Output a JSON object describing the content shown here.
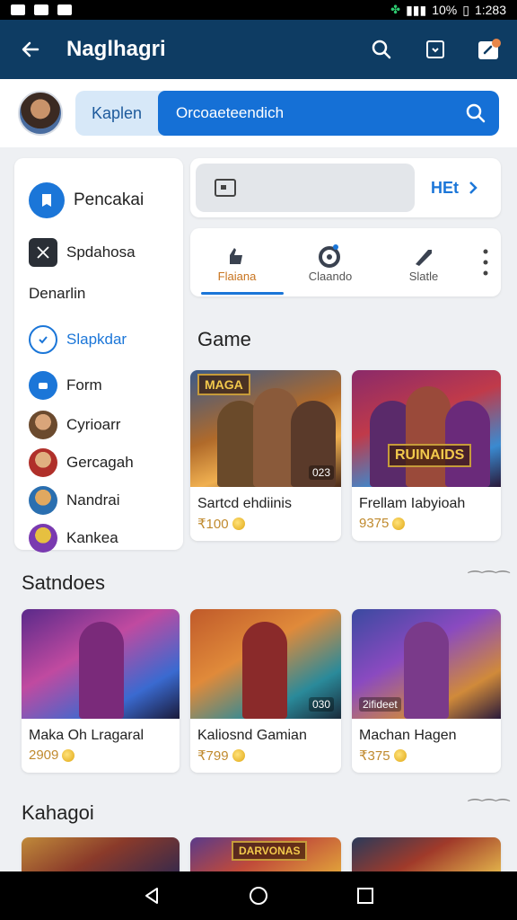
{
  "status": {
    "battery": "10%",
    "time": "1:283"
  },
  "appbar": {
    "title": "Naglhagri"
  },
  "search": {
    "tag": "Kaplen",
    "placeholder": "Orcoaeteendich"
  },
  "sidebar": {
    "items": [
      {
        "label": "Pencakai",
        "icon": "bookmark-icon"
      },
      {
        "label": "Spdahosa",
        "icon": "image-icon"
      },
      {
        "label": "Denarlin",
        "icon": ""
      },
      {
        "label": "Slapkdar",
        "icon": "badge-icon"
      },
      {
        "label": "Form",
        "icon": "user-icon"
      },
      {
        "label": "Cyrioarr",
        "icon": "avatar-icon"
      },
      {
        "label": "Gercagah",
        "icon": "avatar-icon"
      },
      {
        "label": "Nandrai",
        "icon": "avatar-icon"
      },
      {
        "label": "Kankea",
        "icon": "avatar-icon"
      }
    ]
  },
  "promo": {
    "more_label": "HEt"
  },
  "tabs": [
    {
      "label": "Flaiana",
      "icon": "hand-icon"
    },
    {
      "label": "Claando",
      "icon": "target-icon"
    },
    {
      "label": "Slatle",
      "icon": "sword-icon"
    }
  ],
  "sections": {
    "game": {
      "title": "Game",
      "cards": [
        {
          "name": "Sartcd ehdiinis",
          "price": "₹100",
          "badge": "023",
          "img_title": "MAGA"
        },
        {
          "name": "Frellam Iabyioah",
          "price": "9375",
          "badge": "",
          "img_title": "RUINAIDS"
        }
      ]
    },
    "satndoes": {
      "title": "Satndoes",
      "more": "⁀⁀⁀",
      "cards": [
        {
          "name": "Maka Oh Lragaral",
          "price": "2909",
          "badge": ""
        },
        {
          "name": "Kaliosnd Gamian",
          "price": "₹799",
          "badge": "030"
        },
        {
          "name": "Machan Hagen",
          "price": "₹375",
          "badge": "2ifideet"
        }
      ]
    },
    "kahagoi": {
      "title": "Kahagoi",
      "more": "⁀⁀⁀",
      "cards": [
        {
          "img_title": ""
        },
        {
          "img_title": "DARVONAS"
        },
        {
          "img_title": ""
        }
      ]
    }
  },
  "colors": {
    "appbar": "#0e3c63",
    "accent": "#1b76d8",
    "price": "#c08a2e"
  }
}
